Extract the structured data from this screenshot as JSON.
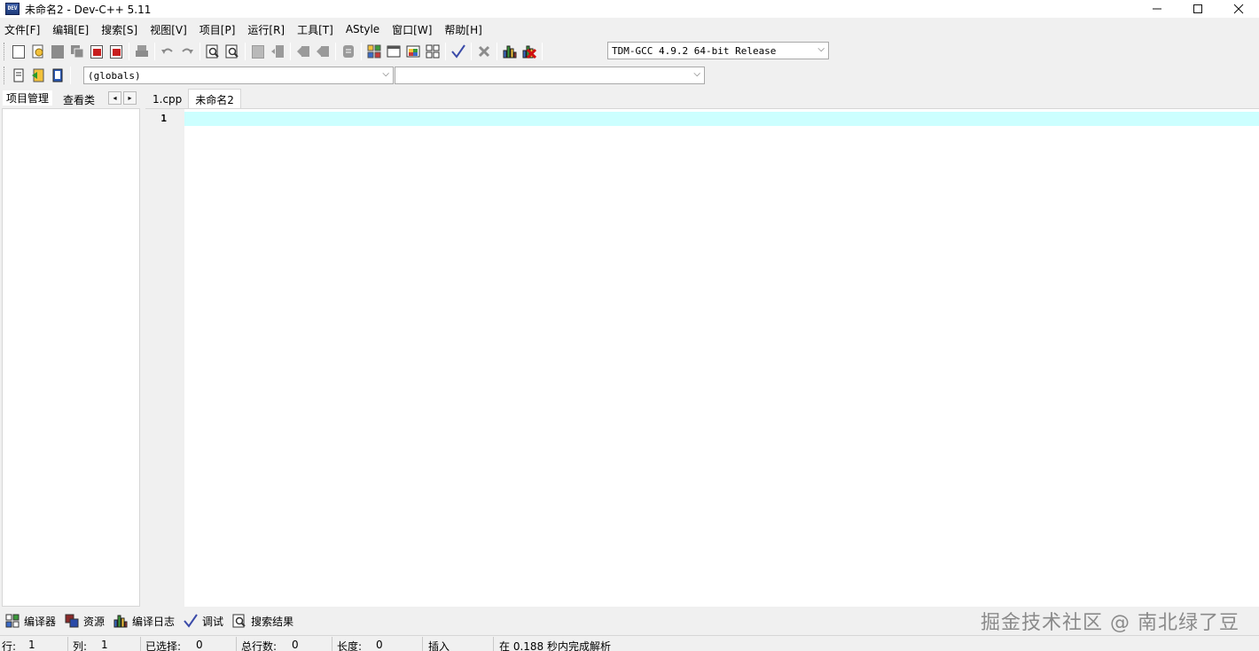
{
  "window": {
    "icon_text": "DEV",
    "title": "未命名2 - Dev-C++ 5.11"
  },
  "menu": [
    "文件[F]",
    "编辑[E]",
    "搜索[S]",
    "视图[V]",
    "项目[P]",
    "运行[R]",
    "工具[T]",
    "AStyle",
    "窗口[W]",
    "帮助[H]"
  ],
  "toolbar": {
    "compiler_select": "TDM-GCC 4.9.2 64-bit Release",
    "scope_select": "(globals)",
    "function_select": ""
  },
  "left_panel": {
    "tabs": [
      "项目管理",
      "查看类"
    ],
    "arrow_left": "◂",
    "arrow_right": "▸"
  },
  "editor": {
    "tabs": [
      "1.cpp",
      "未命名2"
    ],
    "active_tab": "未命名2",
    "line_numbers": [
      "1"
    ],
    "current_line_color": "#ccffff"
  },
  "bottom_tabs": [
    "编译器",
    "资源",
    "编译日志",
    "调试",
    "搜索结果"
  ],
  "watermark": "掘金技术社区 @ 南北绿了豆",
  "status": {
    "row_label": "行:",
    "row_value": "1",
    "col_label": "列:",
    "col_value": "1",
    "selected_label": "已选择:",
    "selected_value": "0",
    "total_label": "总行数:",
    "total_value": "0",
    "length_label": "长度:",
    "length_value": "0",
    "mode": "插入",
    "message": "在 0.188 秒内完成解析"
  }
}
